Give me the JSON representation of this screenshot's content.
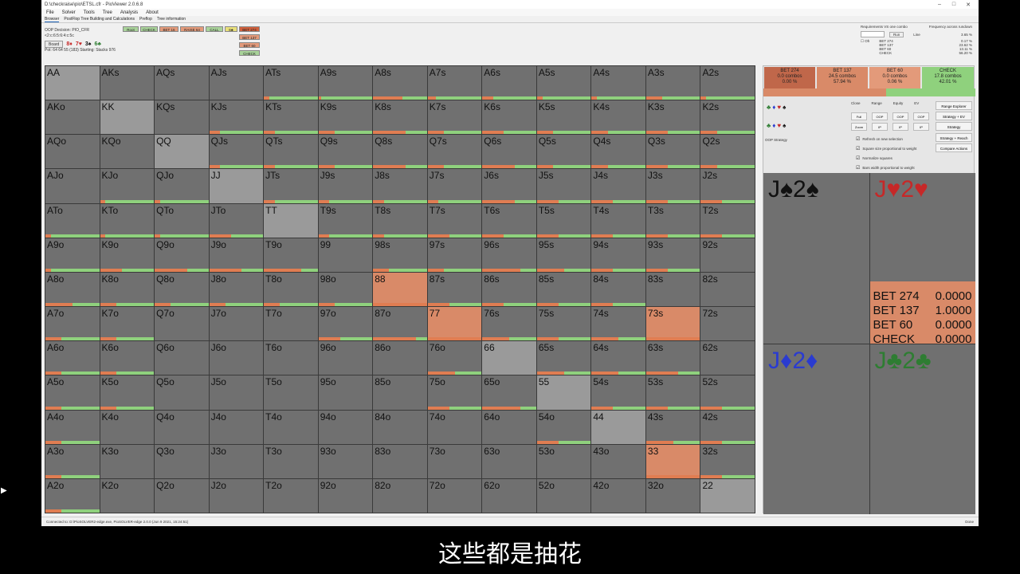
{
  "window": {
    "title": "D:\\checkraise\\pio\\ETSL.cfr - PioViewer 2.0.6.8"
  },
  "menu": [
    "File",
    "Solver",
    "Tools",
    "Tree",
    "Analysis",
    "About"
  ],
  "tabs": [
    "Browser",
    "PostFlop Tree Building and Calculations",
    "Preflop",
    "Tree information"
  ],
  "oop": {
    "decision": "OOP Decision:  PIO_CFR",
    "line": "<2:c:6:5:6:4:c:5c",
    "board_btn": "Board",
    "board_cards": [
      {
        "text": "8♦",
        "color": "red"
      },
      {
        "text": "7♥",
        "color": "red"
      },
      {
        "text": "3♠",
        "color": "black"
      },
      {
        "text": "6♣",
        "color": "green"
      }
    ],
    "pot": "Pot: 64 64 55 (183) Starting: Stacks 976"
  },
  "actions": [
    {
      "label": "Root",
      "color": "#a9d39a"
    },
    {
      "label": "CHECK",
      "color": "#a9d39a"
    },
    {
      "label": "BET 16",
      "color": "#e39a7a"
    },
    {
      "label": "RAISE 64",
      "color": "#e39a7a"
    },
    {
      "label": "CALL",
      "color": "#a9d39a"
    },
    {
      "label": "6♣",
      "color": "#e9e07a"
    },
    {
      "label": "BET 274",
      "color": "#d0603c"
    },
    {
      "label": "BET 137",
      "color": "#e39a7a"
    },
    {
      "label": "BET 60",
      "color": "#e39a7a"
    },
    {
      "label": "CHECK",
      "color": "#a9d39a"
    }
  ],
  "right_controls": {
    "req_label": "Requirements VS one combo",
    "run": "Run",
    "freq_label": "Frequency across rundown",
    "line_label": "Line",
    "line_val": "3.65 %",
    "oh": "Oh",
    "freq": [
      {
        "k": "BET 274",
        "v": "0.17 %"
      },
      {
        "k": "BET 137",
        "v": "23.62 %"
      },
      {
        "k": "BET 60",
        "v": "13.11 %"
      },
      {
        "k": "CHECK",
        "v": "56.20 %"
      }
    ]
  },
  "grid": [
    {
      "h": "AA",
      "b": 0,
      "c": 0,
      "s": 0
    },
    {
      "h": "AKs",
      "b": 0,
      "c": 0,
      "s": 0
    },
    {
      "h": "AQs",
      "b": 0,
      "c": 0,
      "s": 0
    },
    {
      "h": "AJs",
      "b": 0,
      "c": 0,
      "s": 0
    },
    {
      "h": "ATs",
      "b": 10,
      "c": 90,
      "s": 1
    },
    {
      "h": "A9s",
      "b": 5,
      "c": 95,
      "s": 1
    },
    {
      "h": "A8s",
      "b": 55,
      "c": 45,
      "s": 1
    },
    {
      "h": "A7s",
      "b": 15,
      "c": 85,
      "s": 1
    },
    {
      "h": "A6s",
      "b": 20,
      "c": 80,
      "s": 1
    },
    {
      "h": "A5s",
      "b": 10,
      "c": 90,
      "s": 1
    },
    {
      "h": "A4s",
      "b": 10,
      "c": 90,
      "s": 1
    },
    {
      "h": "A3s",
      "b": 30,
      "c": 70,
      "s": 1
    },
    {
      "h": "A2s",
      "b": 10,
      "c": 90,
      "s": 1
    },
    {
      "h": "AKo",
      "b": 0,
      "c": 0,
      "s": 0
    },
    {
      "h": "KK",
      "b": 0,
      "c": 0,
      "s": 0
    },
    {
      "h": "KQs",
      "b": 0,
      "c": 0,
      "s": 0
    },
    {
      "h": "KJs",
      "b": 20,
      "c": 80,
      "s": 1
    },
    {
      "h": "KTs",
      "b": 20,
      "c": 80,
      "s": 1
    },
    {
      "h": "K9s",
      "b": 30,
      "c": 70,
      "s": 1
    },
    {
      "h": "K8s",
      "b": 60,
      "c": 40,
      "s": 1
    },
    {
      "h": "K7s",
      "b": 30,
      "c": 70,
      "s": 1
    },
    {
      "h": "K6s",
      "b": 40,
      "c": 60,
      "s": 1
    },
    {
      "h": "K5s",
      "b": 30,
      "c": 70,
      "s": 1
    },
    {
      "h": "K4s",
      "b": 30,
      "c": 70,
      "s": 1
    },
    {
      "h": "K3s",
      "b": 40,
      "c": 60,
      "s": 1
    },
    {
      "h": "K2s",
      "b": 30,
      "c": 70,
      "s": 1
    },
    {
      "h": "AQo",
      "b": 0,
      "c": 0,
      "s": 0
    },
    {
      "h": "KQo",
      "b": 0,
      "c": 0,
      "s": 0
    },
    {
      "h": "QQ",
      "b": 0,
      "c": 0,
      "s": 0
    },
    {
      "h": "QJs",
      "b": 20,
      "c": 80,
      "s": 1
    },
    {
      "h": "QTs",
      "b": 20,
      "c": 80,
      "s": 1
    },
    {
      "h": "Q9s",
      "b": 30,
      "c": 70,
      "s": 1
    },
    {
      "h": "Q8s",
      "b": 60,
      "c": 40,
      "s": 1
    },
    {
      "h": "Q7s",
      "b": 30,
      "c": 70,
      "s": 1
    },
    {
      "h": "Q6s",
      "b": 60,
      "c": 40,
      "s": 1
    },
    {
      "h": "Q5s",
      "b": 30,
      "c": 70,
      "s": 1
    },
    {
      "h": "Q4s",
      "b": 30,
      "c": 70,
      "s": 1
    },
    {
      "h": "Q3s",
      "b": 40,
      "c": 60,
      "s": 1
    },
    {
      "h": "Q2s",
      "b": 30,
      "c": 70,
      "s": 1
    },
    {
      "h": "AJo",
      "b": 0,
      "c": 0,
      "s": 0
    },
    {
      "h": "KJo",
      "b": 10,
      "c": 90,
      "s": 1
    },
    {
      "h": "QJo",
      "b": 10,
      "c": 90,
      "s": 1
    },
    {
      "h": "JJ",
      "b": 0,
      "c": 0,
      "s": 0
    },
    {
      "h": "JTs",
      "b": 20,
      "c": 80,
      "s": 1
    },
    {
      "h": "J9s",
      "b": 20,
      "c": 80,
      "s": 1
    },
    {
      "h": "J8s",
      "b": 20,
      "c": 80,
      "s": 1
    },
    {
      "h": "J7s",
      "b": 20,
      "c": 80,
      "s": 1
    },
    {
      "h": "J6s",
      "b": 60,
      "c": 40,
      "s": 1
    },
    {
      "h": "J5s",
      "b": 40,
      "c": 60,
      "s": 1
    },
    {
      "h": "J4s",
      "b": 40,
      "c": 60,
      "s": 1
    },
    {
      "h": "J3s",
      "b": 40,
      "c": 60,
      "s": 1
    },
    {
      "h": "J2s",
      "b": 40,
      "c": 60,
      "s": 1
    },
    {
      "h": "ATo",
      "b": 10,
      "c": 90,
      "s": 1
    },
    {
      "h": "KTo",
      "b": 10,
      "c": 90,
      "s": 1
    },
    {
      "h": "QTo",
      "b": 10,
      "c": 90,
      "s": 1
    },
    {
      "h": "JTo",
      "b": 40,
      "c": 60,
      "s": 1
    },
    {
      "h": "TT",
      "b": 0,
      "c": 0,
      "s": 0
    },
    {
      "h": "T9s",
      "b": 20,
      "c": 80,
      "s": 1
    },
    {
      "h": "T8s",
      "b": 20,
      "c": 80,
      "s": 1
    },
    {
      "h": "T7s",
      "b": 40,
      "c": 60,
      "s": 1
    },
    {
      "h": "T6s",
      "b": 40,
      "c": 60,
      "s": 1
    },
    {
      "h": "T5s",
      "b": 40,
      "c": 60,
      "s": 1
    },
    {
      "h": "T4s",
      "b": 40,
      "c": 60,
      "s": 1
    },
    {
      "h": "T3s",
      "b": 40,
      "c": 60,
      "s": 1
    },
    {
      "h": "T2s",
      "b": 40,
      "c": 60,
      "s": 1
    },
    {
      "h": "A9o",
      "b": 10,
      "c": 90,
      "s": 1
    },
    {
      "h": "K9o",
      "b": 40,
      "c": 60,
      "s": 1
    },
    {
      "h": "Q9o",
      "b": 60,
      "c": 40,
      "s": 1
    },
    {
      "h": "J9o",
      "b": 60,
      "c": 40,
      "s": 1
    },
    {
      "h": "T9o",
      "b": 70,
      "c": 30,
      "s": 1
    },
    {
      "h": "99",
      "b": 0,
      "c": 0,
      "s": 1
    },
    {
      "h": "98s",
      "b": 30,
      "c": 70,
      "s": 1
    },
    {
      "h": "97s",
      "b": 30,
      "c": 70,
      "s": 1
    },
    {
      "h": "96s",
      "b": 70,
      "c": 30,
      "s": 1
    },
    {
      "h": "95s",
      "b": 50,
      "c": 50,
      "s": 1
    },
    {
      "h": "94s",
      "b": 40,
      "c": 60,
      "s": 1
    },
    {
      "h": "93s",
      "b": 40,
      "c": 60,
      "s": 1
    },
    {
      "h": "92s",
      "b": 0,
      "c": 0,
      "s": 0
    },
    {
      "h": "A8o",
      "b": 50,
      "c": 50,
      "s": 1
    },
    {
      "h": "K8o",
      "b": 30,
      "c": 70,
      "s": 1
    },
    {
      "h": "Q8o",
      "b": 30,
      "c": 70,
      "s": 1
    },
    {
      "h": "J8o",
      "b": 30,
      "c": 70,
      "s": 1
    },
    {
      "h": "T8o",
      "b": 30,
      "c": 70,
      "s": 1
    },
    {
      "h": "98o",
      "b": 30,
      "c": 70,
      "s": 1
    },
    {
      "h": "88",
      "b": 100,
      "c": 0,
      "s": 2
    },
    {
      "h": "87s",
      "b": 40,
      "c": 60,
      "s": 1
    },
    {
      "h": "86s",
      "b": 40,
      "c": 60,
      "s": 1
    },
    {
      "h": "85s",
      "b": 40,
      "c": 60,
      "s": 1
    },
    {
      "h": "84s",
      "b": 40,
      "c": 60,
      "s": 1
    },
    {
      "h": "83s",
      "b": 0,
      "c": 0,
      "s": 0
    },
    {
      "h": "82s",
      "b": 0,
      "c": 0,
      "s": 0
    },
    {
      "h": "A7o",
      "b": 30,
      "c": 70,
      "s": 1
    },
    {
      "h": "K7o",
      "b": 30,
      "c": 70,
      "s": 1
    },
    {
      "h": "Q7o",
      "b": 0,
      "c": 0,
      "s": 0
    },
    {
      "h": "J7o",
      "b": 0,
      "c": 0,
      "s": 0
    },
    {
      "h": "T7o",
      "b": 0,
      "c": 0,
      "s": 0
    },
    {
      "h": "97o",
      "b": 40,
      "c": 60,
      "s": 1
    },
    {
      "h": "87o",
      "b": 80,
      "c": 20,
      "s": 1
    },
    {
      "h": "77",
      "b": 100,
      "c": 0,
      "s": 2
    },
    {
      "h": "76s",
      "b": 50,
      "c": 50,
      "s": 1
    },
    {
      "h": "75s",
      "b": 40,
      "c": 60,
      "s": 1
    },
    {
      "h": "74s",
      "b": 50,
      "c": 50,
      "s": 1
    },
    {
      "h": "73s",
      "b": 100,
      "c": 0,
      "s": 2
    },
    {
      "h": "72s",
      "b": 0,
      "c": 0,
      "s": 0
    },
    {
      "h": "A6o",
      "b": 30,
      "c": 70,
      "s": 1
    },
    {
      "h": "K6o",
      "b": 30,
      "c": 70,
      "s": 1
    },
    {
      "h": "Q6o",
      "b": 0,
      "c": 0,
      "s": 0
    },
    {
      "h": "J6o",
      "b": 0,
      "c": 0,
      "s": 0
    },
    {
      "h": "T6o",
      "b": 0,
      "c": 0,
      "s": 0
    },
    {
      "h": "96o",
      "b": 0,
      "c": 0,
      "s": 0
    },
    {
      "h": "86o",
      "b": 0,
      "c": 0,
      "s": 0
    },
    {
      "h": "76o",
      "b": 50,
      "c": 50,
      "s": 1
    },
    {
      "h": "66",
      "b": 0,
      "c": 0,
      "s": 0
    },
    {
      "h": "65s",
      "b": 50,
      "c": 50,
      "s": 1
    },
    {
      "h": "64s",
      "b": 50,
      "c": 50,
      "s": 1
    },
    {
      "h": "63s",
      "b": 60,
      "c": 40,
      "s": 1
    },
    {
      "h": "62s",
      "b": 0,
      "c": 0,
      "s": 0
    },
    {
      "h": "A5o",
      "b": 30,
      "c": 70,
      "s": 1
    },
    {
      "h": "K5o",
      "b": 30,
      "c": 70,
      "s": 1
    },
    {
      "h": "Q5o",
      "b": 0,
      "c": 0,
      "s": 0
    },
    {
      "h": "J5o",
      "b": 0,
      "c": 0,
      "s": 0
    },
    {
      "h": "T5o",
      "b": 0,
      "c": 0,
      "s": 0
    },
    {
      "h": "95o",
      "b": 0,
      "c": 0,
      "s": 0
    },
    {
      "h": "85o",
      "b": 0,
      "c": 0,
      "s": 0
    },
    {
      "h": "75o",
      "b": 40,
      "c": 60,
      "s": 1
    },
    {
      "h": "65o",
      "b": 70,
      "c": 30,
      "s": 1
    },
    {
      "h": "55",
      "b": 0,
      "c": 0,
      "s": 0
    },
    {
      "h": "54s",
      "b": 40,
      "c": 60,
      "s": 1
    },
    {
      "h": "53s",
      "b": 40,
      "c": 60,
      "s": 1
    },
    {
      "h": "52s",
      "b": 40,
      "c": 60,
      "s": 1
    },
    {
      "h": "A4o",
      "b": 30,
      "c": 70,
      "s": 1
    },
    {
      "h": "K4o",
      "b": 0,
      "c": 0,
      "s": 0
    },
    {
      "h": "Q4o",
      "b": 0,
      "c": 0,
      "s": 0
    },
    {
      "h": "J4o",
      "b": 0,
      "c": 0,
      "s": 0
    },
    {
      "h": "T4o",
      "b": 0,
      "c": 0,
      "s": 0
    },
    {
      "h": "94o",
      "b": 0,
      "c": 0,
      "s": 0
    },
    {
      "h": "84o",
      "b": 0,
      "c": 0,
      "s": 0
    },
    {
      "h": "74o",
      "b": 0,
      "c": 0,
      "s": 0
    },
    {
      "h": "64o",
      "b": 0,
      "c": 0,
      "s": 0
    },
    {
      "h": "54o",
      "b": 40,
      "c": 60,
      "s": 1
    },
    {
      "h": "44",
      "b": 0,
      "c": 0,
      "s": 0
    },
    {
      "h": "43s",
      "b": 50,
      "c": 50,
      "s": 1
    },
    {
      "h": "42s",
      "b": 40,
      "c": 60,
      "s": 1
    },
    {
      "h": "A3o",
      "b": 30,
      "c": 70,
      "s": 1
    },
    {
      "h": "K3o",
      "b": 0,
      "c": 0,
      "s": 0
    },
    {
      "h": "Q3o",
      "b": 0,
      "c": 0,
      "s": 0
    },
    {
      "h": "J3o",
      "b": 0,
      "c": 0,
      "s": 0
    },
    {
      "h": "T3o",
      "b": 0,
      "c": 0,
      "s": 0
    },
    {
      "h": "93o",
      "b": 0,
      "c": 0,
      "s": 0
    },
    {
      "h": "83o",
      "b": 0,
      "c": 0,
      "s": 0
    },
    {
      "h": "73o",
      "b": 0,
      "c": 0,
      "s": 0
    },
    {
      "h": "63o",
      "b": 0,
      "c": 0,
      "s": 0
    },
    {
      "h": "53o",
      "b": 0,
      "c": 0,
      "s": 0
    },
    {
      "h": "43o",
      "b": 0,
      "c": 0,
      "s": 0
    },
    {
      "h": "33",
      "b": 100,
      "c": 0,
      "s": 2
    },
    {
      "h": "32s",
      "b": 40,
      "c": 60,
      "s": 1
    },
    {
      "h": "A2o",
      "b": 30,
      "c": 70,
      "s": 1
    },
    {
      "h": "K2o",
      "b": 0,
      "c": 0,
      "s": 0
    },
    {
      "h": "Q2o",
      "b": 0,
      "c": 0,
      "s": 0
    },
    {
      "h": "J2o",
      "b": 0,
      "c": 0,
      "s": 0
    },
    {
      "h": "T2o",
      "b": 0,
      "c": 0,
      "s": 0
    },
    {
      "h": "92o",
      "b": 0,
      "c": 0,
      "s": 0
    },
    {
      "h": "82o",
      "b": 0,
      "c": 0,
      "s": 0
    },
    {
      "h": "72o",
      "b": 0,
      "c": 0,
      "s": 0
    },
    {
      "h": "62o",
      "b": 0,
      "c": 0,
      "s": 0
    },
    {
      "h": "52o",
      "b": 0,
      "c": 0,
      "s": 0
    },
    {
      "h": "42o",
      "b": 0,
      "c": 0,
      "s": 0
    },
    {
      "h": "32o",
      "b": 0,
      "c": 0,
      "s": 0
    },
    {
      "h": "22",
      "b": 0,
      "c": 0,
      "s": 0
    }
  ],
  "summary": [
    {
      "a": "BET 274",
      "combos": "0.0 combos",
      "pct": "0.00 %",
      "color": "#c0674a"
    },
    {
      "a": "BET 137",
      "combos": "24.5 combos",
      "pct": "57.94 %",
      "color": "#d98a68"
    },
    {
      "a": "BET 60",
      "combos": "0.0 combos",
      "pct": "0.06 %",
      "color": "#e39a7a"
    },
    {
      "a": "CHECK",
      "combos": "17.8 combos",
      "pct": "42.01 %",
      "color": "#8fd17d"
    }
  ],
  "suits": [
    "♣",
    "♦",
    "♥",
    "♠"
  ],
  "ctrl_headers": [
    "Close",
    "Range",
    "Equity",
    "EV"
  ],
  "ctrl_buttons": [
    "Full",
    "OOP",
    "OOP",
    "OOP",
    "Zoom",
    "IP",
    "IP",
    "IP"
  ],
  "right_buttons": [
    "Range Explorer",
    "Strategy + EV",
    "Strategy",
    "Strategy + Reach",
    "Compare Actions"
  ],
  "checkboxes": [
    "Refresh on new selection",
    "Square size proportional to weight",
    "Normalize squares",
    "Bars width proportional to weight"
  ],
  "oop_strategy": "OOP Strategy",
  "combos": [
    {
      "rank1": "J",
      "s1": "♠",
      "rank2": "2",
      "s2": "♠",
      "color": "black"
    },
    {
      "rank1": "J",
      "s1": "♥",
      "rank2": "2",
      "s2": "♥",
      "color": "red"
    },
    {
      "rank1": "J",
      "s1": "♦",
      "rank2": "2",
      "s2": "♦",
      "color": "blue"
    },
    {
      "rank1": "J",
      "s1": "♣",
      "rank2": "2",
      "s2": "♣",
      "color": "green"
    }
  ],
  "combo_strategy": [
    {
      "k": "BET 274",
      "v": "0.0000"
    },
    {
      "k": "BET 137",
      "v": "1.0000"
    },
    {
      "k": "BET 60",
      "v": "0.0000"
    },
    {
      "k": "CHECK",
      "v": "0.0000"
    }
  ],
  "status": {
    "left": "Connected to: D:\\PioSOLVER2-edge.exe, PioSOLVER-edge 2.0.0 (Jun 9 2021, 15:24:51)",
    "right": "Done"
  },
  "subtitle": "这些都是抽花"
}
